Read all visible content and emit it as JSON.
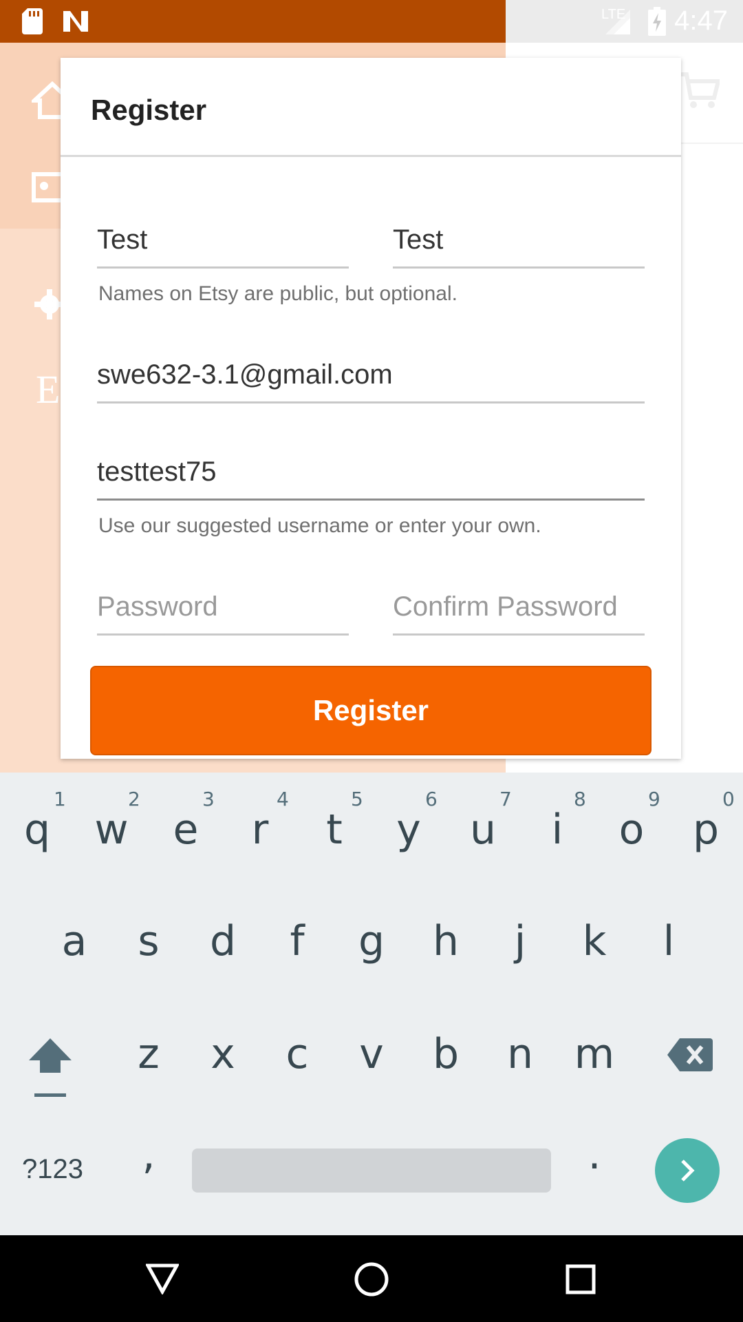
{
  "status_bar": {
    "time": "4:47",
    "network": "LTE",
    "icons": [
      "sd-card-icon",
      "n-notification-icon",
      "signal-icon",
      "battery-charging-icon"
    ]
  },
  "background": {
    "drawer_letter": "E",
    "icons": [
      "home-icon",
      "profile-card-icon",
      "gear-icon",
      "cart-icon"
    ]
  },
  "dialog": {
    "title": "Register",
    "first_name": {
      "value": "Test"
    },
    "last_name": {
      "value": "Test"
    },
    "names_hint": "Names on Etsy are public, but optional.",
    "email": {
      "value": "swe632-3.1@gmail.com"
    },
    "username": {
      "value": "testtest75"
    },
    "username_hint": "Use our suggested username or enter your own.",
    "password": {
      "placeholder": "Password"
    },
    "confirm_password": {
      "placeholder": "Confirm Password"
    },
    "register_button": "Register"
  },
  "keyboard": {
    "row1": [
      "q",
      "w",
      "e",
      "r",
      "t",
      "y",
      "u",
      "i",
      "o",
      "p"
    ],
    "row1_numbers": [
      "1",
      "2",
      "3",
      "4",
      "5",
      "6",
      "7",
      "8",
      "9",
      "0"
    ],
    "row2": [
      "a",
      "s",
      "d",
      "f",
      "g",
      "h",
      "j",
      "k",
      "l"
    ],
    "row3": [
      "z",
      "x",
      "c",
      "v",
      "b",
      "n",
      "m"
    ],
    "symbols_key": "?123",
    "comma_key": ",",
    "period_key": "."
  },
  "colors": {
    "accent": "#f56400",
    "status_bar": "#b24a00",
    "enter_key": "#4db6ac"
  }
}
